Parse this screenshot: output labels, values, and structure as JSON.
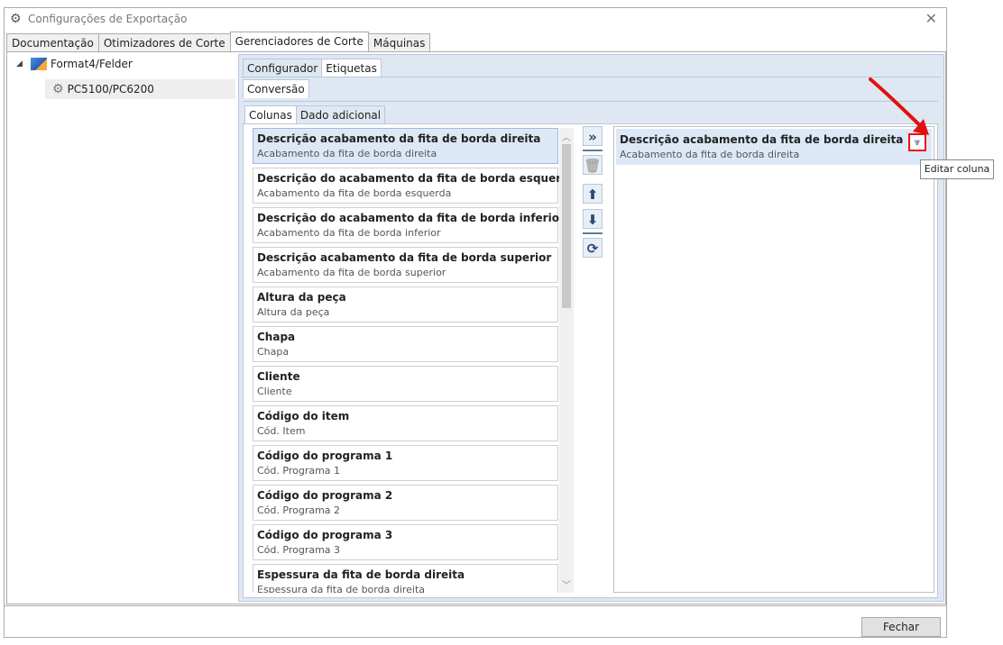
{
  "window": {
    "title": "Configurações de Exportação",
    "close_glyph": "✕",
    "icon": "gear-icon"
  },
  "main_tabs": [
    {
      "label": "Documentação",
      "active": false
    },
    {
      "label": "Otimizadores de Corte",
      "active": false
    },
    {
      "label": "Gerenciadores de Corte",
      "active": true
    },
    {
      "label": "Máquinas",
      "active": false
    }
  ],
  "tree": {
    "root_label": "Format4/Felder",
    "child_label": "PC5100/PC6200"
  },
  "sub_tabs": [
    {
      "label": "Configurador",
      "active": false
    },
    {
      "label": "Etiquetas",
      "active": true
    }
  ],
  "conversion_tab": "Conversão",
  "column_tabs": [
    {
      "label": "Colunas",
      "active": true
    },
    {
      "label": "Dado adicional",
      "active": false
    }
  ],
  "available_columns": [
    {
      "title": "Descrição acabamento da fita de borda direita",
      "sub": "Acabamento da fita de borda direita",
      "selected": true
    },
    {
      "title": "Descrição do acabamento da fita de borda esquerda",
      "sub": "Acabamento da fita de borda esquerda",
      "selected": false
    },
    {
      "title": "Descrição do acabamento da fita de borda inferior",
      "sub": "Acabamento da fita de borda inferior",
      "selected": false
    },
    {
      "title": "Descrição acabamento da fita de borda superior",
      "sub": "Acabamento da fita de borda superior",
      "selected": false
    },
    {
      "title": "Altura da peça",
      "sub": "Altura da peça",
      "selected": false
    },
    {
      "title": "Chapa",
      "sub": "Chapa",
      "selected": false
    },
    {
      "title": "Cliente",
      "sub": "Cliente",
      "selected": false
    },
    {
      "title": "Código do item",
      "sub": "Cód. Item",
      "selected": false
    },
    {
      "title": "Código do programa 1",
      "sub": "Cód. Programa 1",
      "selected": false
    },
    {
      "title": "Código do programa 2",
      "sub": "Cód. Programa 2",
      "selected": false
    },
    {
      "title": "Código do programa 3",
      "sub": "Cód. Programa 3",
      "selected": false
    },
    {
      "title": "Espessura da fita de borda direita",
      "sub": "Espessura da fita de borda direita",
      "selected": false
    }
  ],
  "toolbar": {
    "add_glyph": "»",
    "delete_glyph": "🗑",
    "up_glyph": "⬆",
    "down_glyph": "⬇",
    "refresh_glyph": "⟳"
  },
  "selected_columns": [
    {
      "title": "Descrição acabamento da fita de borda direita",
      "sub": "Acabamento da fita de borda direita"
    }
  ],
  "edit_glyph": "⩔",
  "tooltip": "Editar coluna",
  "annotation_color": "#e11111",
  "footer": {
    "close_label": "Fechar"
  }
}
